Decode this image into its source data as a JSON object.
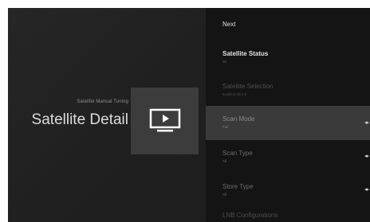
{
  "left": {
    "overline": "Satellite Manual Tuning",
    "title": "Satellite Detail",
    "card_icon": "tv-play-icon"
  },
  "panel": {
    "items": [
      {
        "title": "Next",
        "subtitle": ""
      },
      {
        "title": "Satellite Status",
        "subtitle": "on"
      },
      {
        "title": "Satellite Selection",
        "subtitle": "Eutelsat 28.5 E"
      },
      {
        "title": "Scan Mode",
        "subtitle": "Full"
      },
      {
        "title": "Scan Type",
        "subtitle": "All"
      },
      {
        "title": "Store Type",
        "subtitle": "All"
      },
      {
        "title": "LNB Configurations",
        "subtitle": ""
      }
    ],
    "arrow_icon": "left-right-arrows-icon"
  }
}
